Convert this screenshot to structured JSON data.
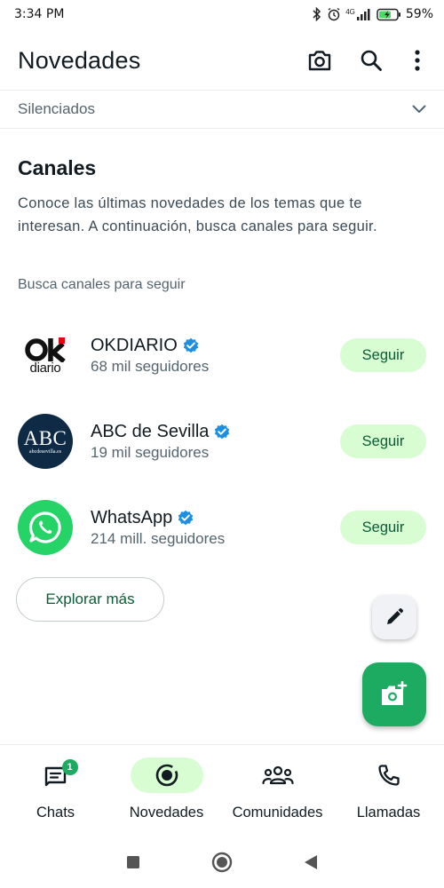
{
  "status_bar": {
    "time": "3:34 PM",
    "network": "4G",
    "battery": "59%"
  },
  "header": {
    "title": "Novedades",
    "icons": [
      "camera-icon",
      "search-icon",
      "more-vert-icon"
    ]
  },
  "muted": {
    "label": "Silenciados"
  },
  "channels": {
    "title": "Canales",
    "description": "Conoce las últimas novedades de los temas que te interesan. A continuación, busca canales para seguir.",
    "find_label": "Busca canales para seguir",
    "items": [
      {
        "name": "OKDIARIO",
        "followers": "68 mil seguidores",
        "follow_label": "Seguir",
        "verified": true,
        "logo_text": "diario"
      },
      {
        "name": "ABC de Sevilla",
        "followers": "19 mil seguidores",
        "follow_label": "Seguir",
        "verified": true,
        "logo_text": "ABC",
        "logo_subtext": "abcdesevilla.es"
      },
      {
        "name": "WhatsApp",
        "followers": "214 mill. seguidores",
        "follow_label": "Seguir",
        "verified": true
      }
    ],
    "explore_label": "Explorar más"
  },
  "colors": {
    "accent": "#1daa61",
    "follow_bg": "#d9fdd3",
    "follow_text": "#0a5c36",
    "verified": "#1d8fe1",
    "abc_bg": "#0f2a44"
  },
  "bottom_nav": {
    "items": [
      {
        "label": "Chats",
        "icon": "chats-icon",
        "badge": "1",
        "active": false
      },
      {
        "label": "Novedades",
        "icon": "updates-icon",
        "active": true
      },
      {
        "label": "Comunidades",
        "icon": "communities-icon",
        "active": false
      },
      {
        "label": "Llamadas",
        "icon": "phone-icon",
        "active": false
      }
    ]
  }
}
